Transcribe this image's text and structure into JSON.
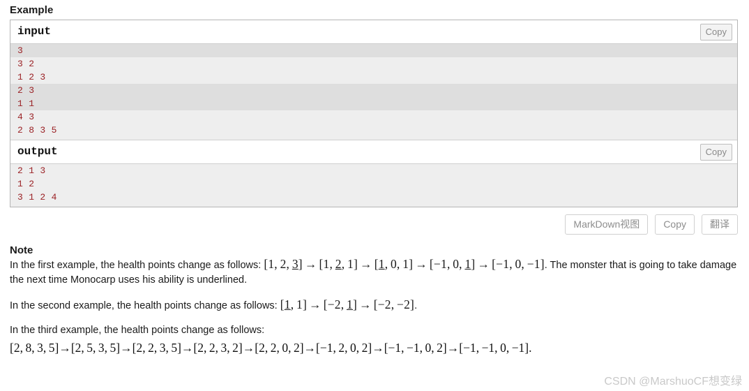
{
  "example": {
    "title": "Example",
    "input": {
      "label": "input",
      "copy_label": "Copy",
      "lines": [
        {
          "text": "3",
          "shaded": true
        },
        {
          "text": "3 2",
          "shaded": false
        },
        {
          "text": "1 2 3",
          "shaded": false
        },
        {
          "text": "2 3",
          "shaded": true
        },
        {
          "text": "1 1",
          "shaded": true
        },
        {
          "text": "4 3",
          "shaded": false
        },
        {
          "text": "2 8 3 5",
          "shaded": false
        }
      ]
    },
    "output": {
      "label": "output",
      "copy_label": "Copy",
      "lines": [
        {
          "text": "2 1 3",
          "shaded": false
        },
        {
          "text": "1 2",
          "shaded": false
        },
        {
          "text": "3 1 2 4",
          "shaded": false
        }
      ]
    }
  },
  "toolbar": {
    "markdown_label": "MarkDown视图",
    "copy_label": "Copy",
    "translate_label": "翻译"
  },
  "note": {
    "title": "Note",
    "para1_prefix": "In the first example, the health points change as follows: ",
    "para1_math": "[1, 2, 3] → [1, 2, 1] → [1, 0, 1] → [−1, 0, 1] → [−1, 0, −1]",
    "para1_suffix": ". The monster that is going to take damage the next time Monocarp uses his ability is underlined.",
    "para2_prefix": "In the second example, the health points change as follows: ",
    "para2_math": "[1, 1] → [−2, 1] → [−2, −2]",
    "para2_suffix": ".",
    "para3_prefix": "In the third example, the health points change as follows:",
    "para3_math": "[2, 8, 3, 5] → [2, 5, 3, 5] → [2, 2, 3, 5] → [2, 2, 3, 2] → [2, 2, 0, 2] → [−1, 2, 0, 2] → [−1, −1, 0, 2] → [−1, −1, 0, −1]",
    "para3_suffix": "."
  },
  "watermark": {
    "text": "CSDN @MarshuoCF想变绿"
  },
  "colors": {
    "code_text": "#9b2226",
    "code_bg": "#eeeeee",
    "code_bg_shaded": "#dedede",
    "border": "#b5b5b5",
    "button_text": "#8d8d8d",
    "watermark": "#c9c9c9"
  }
}
